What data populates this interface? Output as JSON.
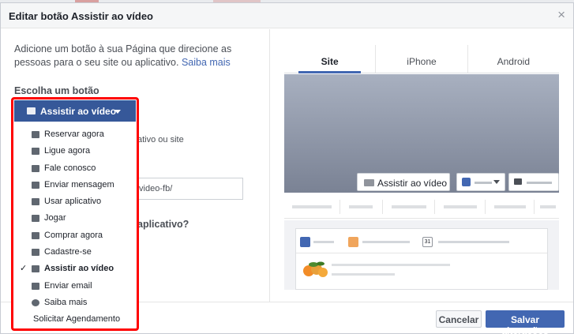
{
  "dialog": {
    "title": "Editar botão Assistir ao vídeo",
    "close_glyph": "×"
  },
  "left": {
    "intro_text": "Adicione um botão à sua Página que direcione as pessoas para o seu site ou aplicativo.",
    "learn_more_link": "Saiba mais",
    "section_label": "Escolha um botão",
    "partial_1": "ativo ou site",
    "url_value": "/video-fb/",
    "partial_2": "aplicativo?"
  },
  "dropdown": {
    "selected_label": "Assistir ao vídeo",
    "items": [
      {
        "label": "Reservar agora",
        "icon": "calendar-icon"
      },
      {
        "label": "Ligue agora",
        "icon": "phone-icon"
      },
      {
        "label": "Fale conosco",
        "icon": "envelope-icon"
      },
      {
        "label": "Enviar mensagem",
        "icon": "chat-bubble-icon"
      },
      {
        "label": "Usar aplicativo",
        "icon": "cube-icon"
      },
      {
        "label": "Jogar",
        "icon": "gamepad-icon"
      },
      {
        "label": "Comprar agora",
        "icon": "shopping-bag-icon"
      },
      {
        "label": "Cadastre-se",
        "icon": "pencil-icon"
      },
      {
        "label": "Assistir ao vídeo",
        "icon": "video-icon",
        "selected": true,
        "check": "✓"
      },
      {
        "label": "Enviar email",
        "icon": "envelope-icon"
      },
      {
        "label": "Saiba mais",
        "icon": "info-icon"
      },
      {
        "label": "Solicitar Agendamento",
        "icon": ""
      }
    ],
    "highlight_color": "#ff0000",
    "header_color": "#365899"
  },
  "preview": {
    "tabs": [
      {
        "label": "Site",
        "active": true
      },
      {
        "label": "iPhone",
        "active": false
      },
      {
        "label": "Android",
        "active": false
      }
    ],
    "cover_button_label": "Assistir ao vídeo",
    "calendar_day": "31"
  },
  "footer": {
    "cancel_label": "Cancelar",
    "save_label": "Salvar alterações"
  },
  "colors": {
    "accent": "#4267b2",
    "text": "#1d2129"
  }
}
